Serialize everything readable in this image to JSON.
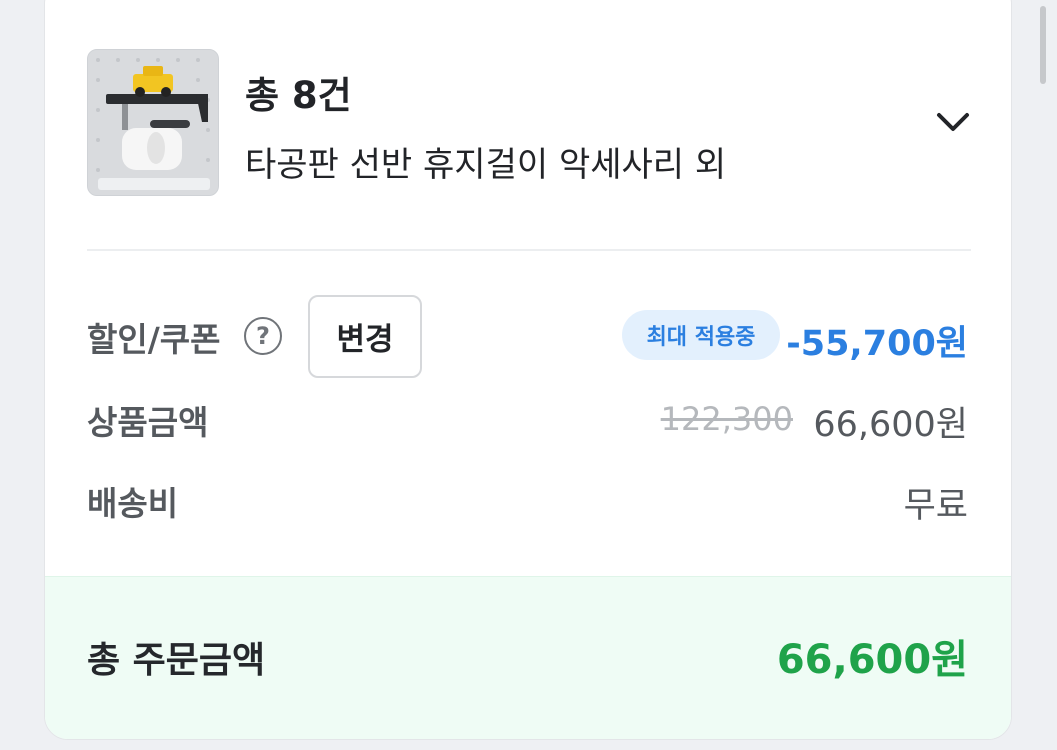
{
  "order_summary": {
    "count_label": "총 8건",
    "product_name": "타공판 선반 휴지걸이 악세사리 외",
    "thumbnail_icon": "product-photo-shelf-toilet-paper-holder",
    "expand_icon": "chevron-down-icon"
  },
  "discount": {
    "label": "할인/쿠폰",
    "help_icon": "question-circle-icon",
    "help_glyph": "?",
    "change_label": "변경",
    "badge": "최대 적용중",
    "value": "-55,700원"
  },
  "product_amount": {
    "label": "상품금액",
    "original": "122,300",
    "value": "66,600원"
  },
  "shipping": {
    "label": "배송비",
    "value": "무료"
  },
  "total": {
    "label": "총 주문금액",
    "value": "66,600원"
  },
  "colors": {
    "accent_blue": "#2b7fe0",
    "accent_green": "#1fa34a",
    "total_background": "#effcf5",
    "badge_background": "#e3f0fd"
  }
}
